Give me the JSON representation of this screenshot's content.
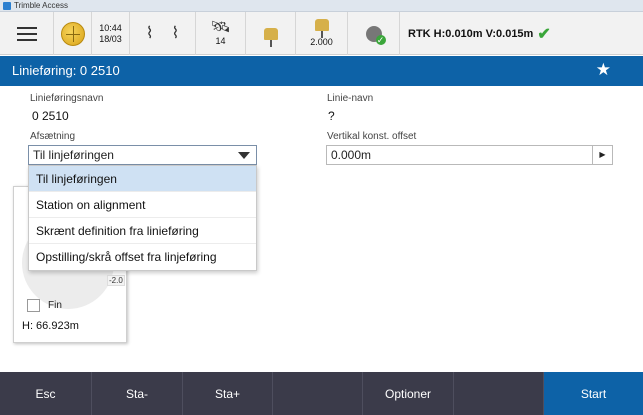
{
  "window": {
    "title": "Trimble Access"
  },
  "status_bar": {
    "time": "10:44",
    "date": "18/03",
    "satellites": "14",
    "antenna_height": "2.000",
    "rtk_status": "RTK H:0.010m V:0.015m"
  },
  "header": {
    "title": "Linieføring: 0 2510"
  },
  "form": {
    "alignment_name_label": "Linieføringsnavn",
    "alignment_name_value": "0 2510",
    "line_name_label": "Linie-navn",
    "line_name_value": "?",
    "stakeout_label": "Afsætning",
    "stakeout_value": "Til linjeføringen",
    "vertical_offset_label": "Vertikal konst. offset",
    "vertical_offset_value": "0.000m"
  },
  "dropdown": {
    "options": [
      "Til linjeføringen",
      "Station on alignment",
      "Skrænt definition fra linieføring",
      "Opstilling/skrå offset fra linjeføring"
    ],
    "selected_index": 0
  },
  "background_panel": {
    "scale_label": "-2.0",
    "fine_label": "Fin",
    "height_value": "H: 66.923m"
  },
  "softkeys": [
    "Esc",
    "Sta-",
    "Sta+",
    "",
    "Optioner",
    "",
    "Start"
  ],
  "colors": {
    "accent": "#0d62a7",
    "softkey_bar": "#3b3b4a",
    "ok": "#3aa63a"
  },
  "icons": [
    "menu-icon",
    "globe-icon",
    "tilt-sensor-icon",
    "satellite-icon",
    "gnss-receiver-icon",
    "radio-link-icon",
    "star-icon",
    "chevron-down-icon",
    "arrow-right-icon"
  ]
}
